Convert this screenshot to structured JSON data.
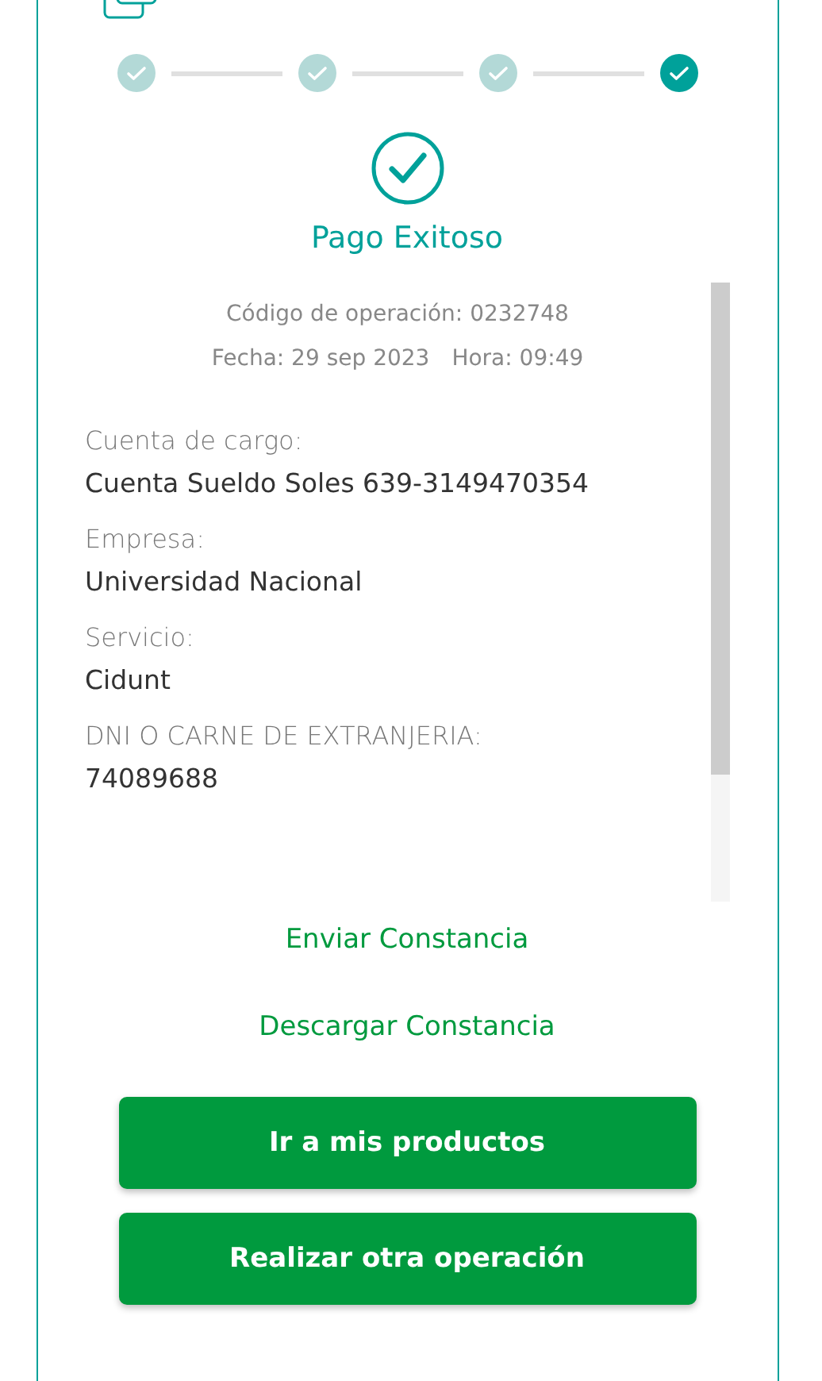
{
  "stepper": {
    "steps": [
      {
        "selected": false
      },
      {
        "selected": false
      },
      {
        "selected": false
      },
      {
        "selected": true
      }
    ]
  },
  "status": {
    "title": "Pago Exitoso"
  },
  "receipt": {
    "operation_code": "Código de operación: 0232748",
    "date": "Fecha: 29 sep 2023",
    "time": "Hora: 09:49",
    "fields": [
      {
        "label": "Cuenta de cargo:",
        "value": "Cuenta Sueldo Soles 639-3149470354"
      },
      {
        "label": "Empresa:",
        "value": "Universidad Nacional"
      },
      {
        "label": "Servicio:",
        "value": "Cidunt"
      },
      {
        "label": "DNI O CARNE DE EXTRANJERIA:",
        "value": "74089688"
      }
    ]
  },
  "links": [
    "Enviar Constancia",
    "Descargar Constancia"
  ],
  "buttons": [
    "Ir a mis productos",
    "Realizar otra operación"
  ]
}
